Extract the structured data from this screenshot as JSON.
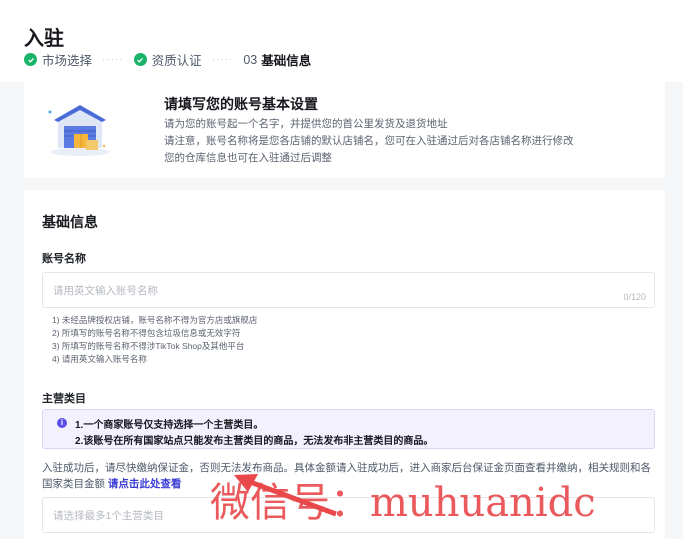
{
  "page": {
    "title": "入驻",
    "steps": [
      {
        "label": "市场选择",
        "done": true
      },
      {
        "label": "资质认证",
        "done": true
      },
      {
        "num": "03",
        "label": "基础信息",
        "current": true
      }
    ]
  },
  "banner": {
    "heading": "请填写您的账号基本设置",
    "lines": [
      "请为您的账号起一个名字，并提供您的首公里发货及退货地址",
      "请注意，账号名称将是您各店铺的默认店铺名，您可在入驻通过后对各店铺名称进行修改",
      "您的仓库信息也可在入驻通过后调整"
    ]
  },
  "form": {
    "section_title": "基础信息",
    "account_name": {
      "label": "账号名称",
      "placeholder": "请用英文输入账号名称",
      "counter": "0/120",
      "hints": [
        "1) 未经品牌授权店铺，账号名称不得为官方店或旗舰店",
        "2) 所填写的账号名称不得包含垃圾信息或无效字符",
        "3) 所填写的账号名称不得涉TikTok Shop及其他平台",
        "4) 请用英文输入账号名称"
      ]
    },
    "category": {
      "label": "主营类目",
      "notice": [
        "1.一个商家账号仅支持选择一个主营类目。",
        "2.该账号在所有国家站点只能发布主营类目的商品，无法发布非主营类目的商品。"
      ],
      "deposit_text": "入驻成功后，请尽快缴纳保证金，否则无法发布商品。具体金额请入驻成功后，进入商家后台保证金页面查看并缴纳，相关规则和各国家类目金额",
      "deposit_link": "请点击此处查看",
      "placeholder": "请选择最多1个主营类目"
    }
  },
  "watermark": "微信号：muhuanidc",
  "colors": {
    "accent": "#5b4fe8",
    "success": "#1bb26a",
    "link": "#3b3ed6",
    "watermark": "#e8484a"
  }
}
